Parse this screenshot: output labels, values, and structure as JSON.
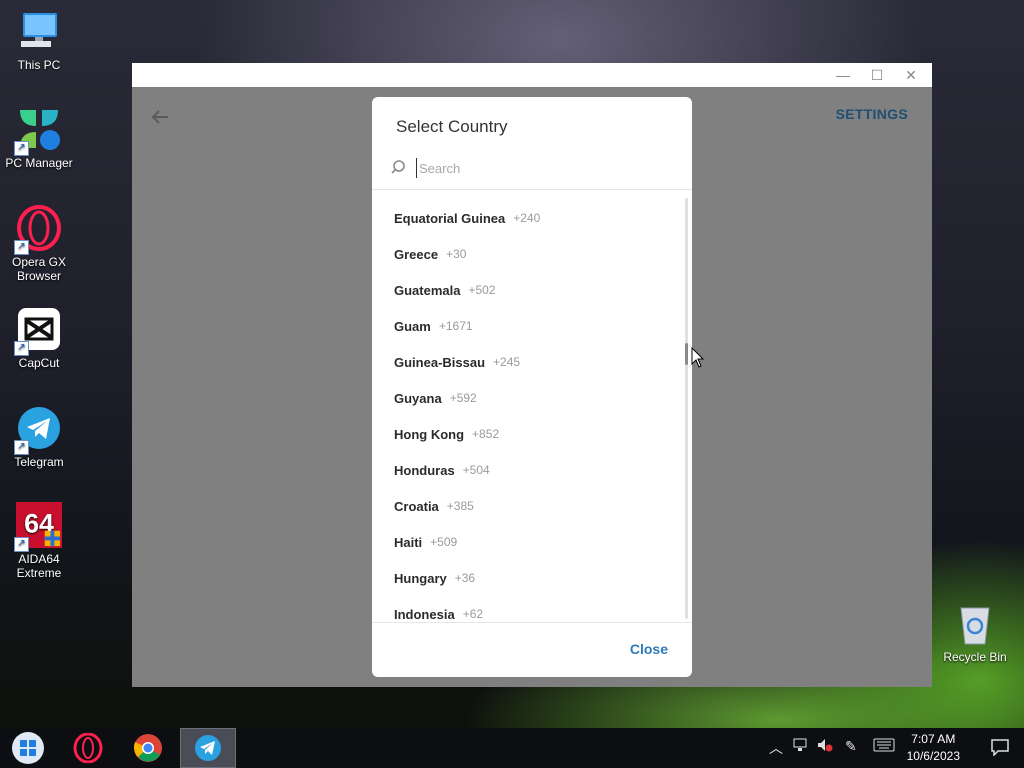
{
  "desktop": {
    "icons": [
      {
        "label": "This PC",
        "icon": "this-pc-icon"
      },
      {
        "label": "PC Manager",
        "icon": "pc-manager-icon"
      },
      {
        "label": "Opera GX\nBrowser",
        "icon": "opera-gx-icon"
      },
      {
        "label": "CapCut",
        "icon": "capcut-icon"
      },
      {
        "label": "Telegram",
        "icon": "telegram-icon"
      },
      {
        "label": "AIDA64\nExtreme",
        "icon": "aida64-icon"
      }
    ],
    "recycle_bin_label": "Recycle Bin"
  },
  "window": {
    "controls": [
      "minimize",
      "maximize",
      "close"
    ],
    "settings_label": "SETTINGS"
  },
  "modal": {
    "title": "Select Country",
    "search_placeholder": "Search",
    "search_value": "",
    "partial_top_label": "...",
    "countries": [
      {
        "name": "Equatorial Guinea",
        "code": "+240"
      },
      {
        "name": "Greece",
        "code": "+30"
      },
      {
        "name": "Guatemala",
        "code": "+502"
      },
      {
        "name": "Guam",
        "code": "+1671"
      },
      {
        "name": "Guinea-Bissau",
        "code": "+245"
      },
      {
        "name": "Guyana",
        "code": "+592"
      },
      {
        "name": "Hong Kong",
        "code": "+852"
      },
      {
        "name": "Honduras",
        "code": "+504"
      },
      {
        "name": "Croatia",
        "code": "+385"
      },
      {
        "name": "Haiti",
        "code": "+509"
      },
      {
        "name": "Hungary",
        "code": "+36"
      },
      {
        "name": "Indonesia",
        "code": "+62"
      }
    ],
    "close_label": "Close"
  },
  "taskbar": {
    "apps": [
      "start-icon",
      "opera-icon",
      "chrome-icon",
      "telegram-icon"
    ],
    "active_app": "telegram",
    "clock_time": "7:07 AM",
    "clock_date": "10/6/2023"
  },
  "colors": {
    "accent": "#2f79b8",
    "settings": "#1f4f70",
    "overlay": "#808080"
  }
}
